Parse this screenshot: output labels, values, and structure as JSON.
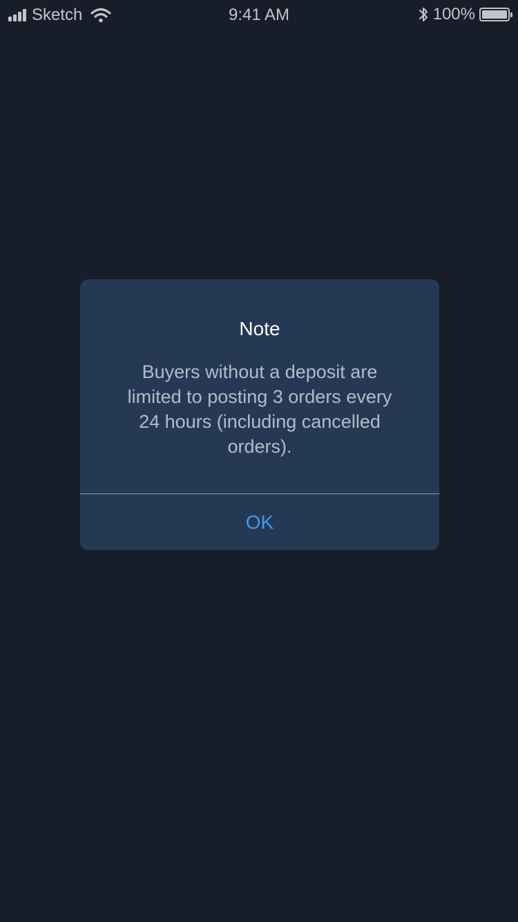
{
  "status_bar": {
    "carrier": "Sketch",
    "time": "9:41 AM",
    "battery_percent": "100%",
    "signal_bars": 4,
    "battery_level": 1.0
  },
  "dialog": {
    "title": "Note",
    "message": "Buyers without a deposit are limited to posting 3 orders every 24 hours (including cancelled orders).",
    "ok_label": "OK"
  },
  "colors": {
    "background": "#171d29",
    "dialog_background": "#253954",
    "accent": "#3d9bf2",
    "title_text": "#ffffff",
    "message_text": "#b3bcc9"
  },
  "icons": [
    "signal-strength-icon",
    "wifi-icon",
    "bluetooth-icon",
    "battery-icon"
  ]
}
